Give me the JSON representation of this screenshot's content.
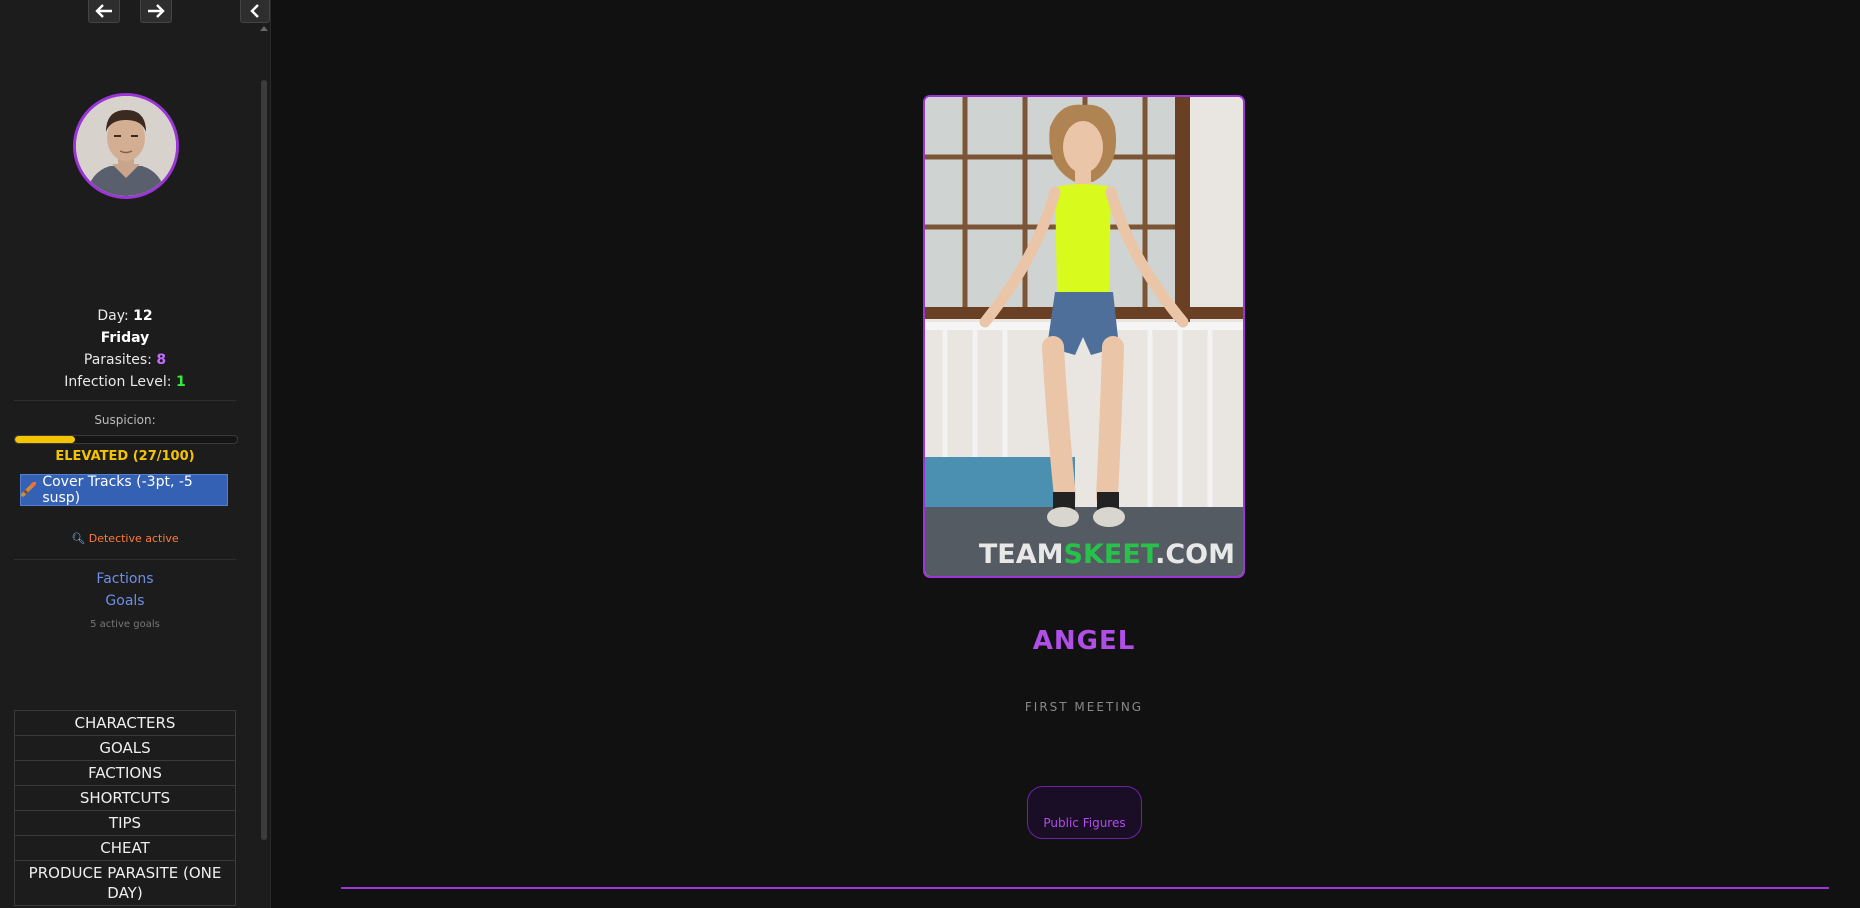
{
  "sidebar": {
    "nav": {
      "back_icon": "arrow-left-icon",
      "forward_icon": "arrow-right-icon",
      "collapse_icon": "chevron-left-icon"
    },
    "stats": {
      "day_label": "Day:",
      "day_value": "12",
      "weekday": "Friday",
      "parasites_label": "Parasites:",
      "parasites_value": "8",
      "infection_label": "Infection Level:",
      "infection_value": "1"
    },
    "suspicion": {
      "label": "Suspicion:",
      "value": 27,
      "max": 100,
      "level_text": "ELEVATED (27/100)",
      "color": "#f5c400"
    },
    "cover_button": {
      "icon": "cigar-icon",
      "label": "Cover Tracks (-3pt, -5 susp)"
    },
    "detective": {
      "icon": "magnifier-icon",
      "text": "Detective active"
    },
    "links": {
      "factions": "Factions",
      "goals": "Goals",
      "goals_count": "5 active goals"
    },
    "menu": [
      "CHARACTERS",
      "GOALS",
      "FACTIONS",
      "SHORTCUTS",
      "TIPS",
      "CHEAT",
      "PRODUCE PARASITE (ONE DAY)"
    ]
  },
  "main": {
    "character": {
      "name": "ANGEL",
      "subtitle": "FIRST MEETING",
      "tag": "Public Figures",
      "watermark_a": "TEAM",
      "watermark_b": "SKEET",
      "watermark_c": ".COM"
    },
    "accent_color": "#9b35d6"
  }
}
